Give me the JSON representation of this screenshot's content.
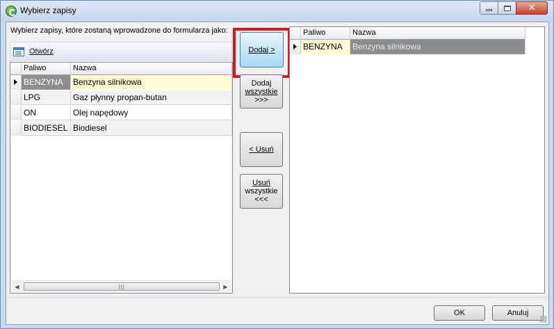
{
  "window": {
    "title": "Wybierz zapisy"
  },
  "instruction": "Wybierz zapisy, które zostaną wprowadzone do formularza jako:",
  "toolbar": {
    "open_label": "Otwórz"
  },
  "columns": {
    "code": "Paliwo",
    "name": "Nazwa"
  },
  "left_rows": [
    {
      "code": "BENZYNA",
      "name": "Benzyna silnikowa"
    },
    {
      "code": "LPG",
      "name": "Gaz płynny propan-butan"
    },
    {
      "code": "ON",
      "name": "Olej napędowy"
    },
    {
      "code": "BIODIESEL",
      "name": "Biodiesel"
    }
  ],
  "right_rows": [
    {
      "code": "BENZYNA",
      "name": "Benzyna silnikowa"
    }
  ],
  "buttons": {
    "add": "Dodaj >",
    "add_all_1": "Dodaj",
    "add_all_2": "wszystkie",
    "add_all_3": ">>>",
    "remove": "< Usuń",
    "remove_all_1": "Usuń",
    "remove_all_2": "wszystkie",
    "remove_all_3": "<<<",
    "ok": "OK",
    "cancel": "Anuluj"
  },
  "colors": {
    "selected_code": "#8d8d8d",
    "selected_name": "#fffbd3",
    "highlight": "#e0141e"
  }
}
